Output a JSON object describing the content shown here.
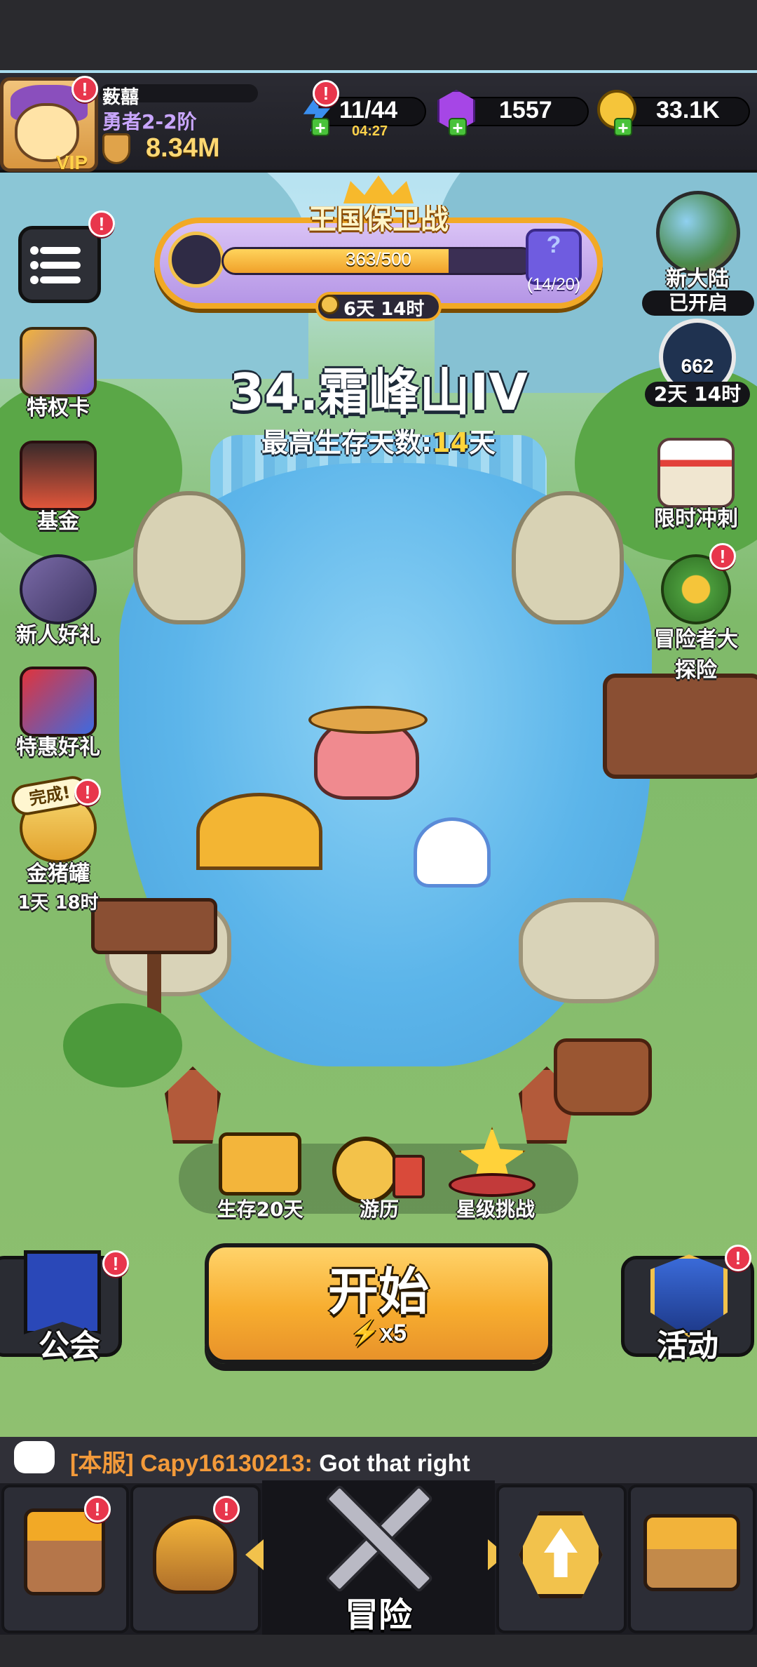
{
  "player": {
    "name": "薮囍",
    "rank": "勇者2-2阶",
    "power": "8.34M",
    "vip_label": "VIP"
  },
  "resources": {
    "energy": "11/44",
    "energy_timer": "04:27",
    "gems": "1557",
    "coins": "33.1K"
  },
  "kingdom_event": {
    "title": "王国保卫战",
    "progress_text": "363/500",
    "progress_fraction": 0.726,
    "gift_count": "(14/20)",
    "gift_glyph": "?",
    "timer": "6天 14时"
  },
  "stage": {
    "title": "34.霜峰山IV",
    "survival_prefix": "最高生存天数:",
    "survival_days": "14",
    "survival_suffix": "天"
  },
  "left_menu": {
    "privilege_card": "特权卡",
    "fund": "基金",
    "newbie_gift": "新人好礼",
    "special_gift": "特惠好礼",
    "complete_badge": "完成!",
    "piggy_bank": "金猪罐",
    "piggy_timer": "1天 18时"
  },
  "right_menu": {
    "new_continent": "新大陆",
    "new_continent_status": "已开启",
    "medal_value": "662",
    "medal_timer": "2天 14时",
    "limited_sprint": "限时冲刺",
    "adventurer_line1": "冒险者大",
    "adventurer_line2": "探险"
  },
  "actions": {
    "survive_20": "生存20天",
    "travel": "游历",
    "star_challenge": "星级挑战"
  },
  "start_button": {
    "label": "开始",
    "cost": "x5"
  },
  "guild_label": "公会",
  "events_label": "活动",
  "chat": {
    "prefix": "[本服] Capy16130213:",
    "message": " Got that right"
  },
  "alert_glyph": "!",
  "nav": {
    "center_label": "冒险"
  },
  "colors": {
    "accent_orange": "#f7ad2f",
    "alert_red": "#e8364c",
    "highlight_yellow": "#ffd43b",
    "chat_prefix": "#f39a3a"
  }
}
